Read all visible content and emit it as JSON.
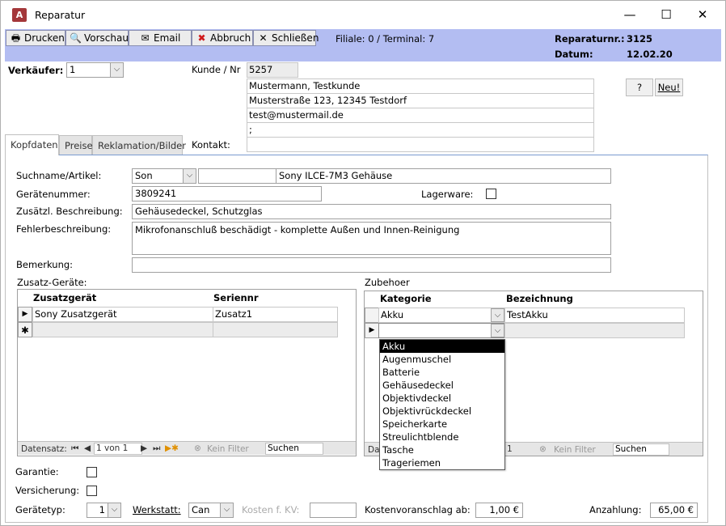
{
  "window": {
    "title": "Reparatur",
    "minimize": "—",
    "maximize": "☐",
    "close": "✕"
  },
  "app_icon": "A",
  "toolbar": {
    "buttons": [
      {
        "label": "Drucken",
        "icon": "🖶"
      },
      {
        "label": "Vorschau",
        "icon": "🔍"
      },
      {
        "label": "Email",
        "icon": "✉"
      },
      {
        "label": "Abbruch",
        "icon": "✖"
      },
      {
        "label": "Schließen",
        "icon": "✕"
      }
    ],
    "filiale": "Filiale: 0 / Terminal:  7",
    "rep_label": "Reparaturnr.:",
    "rep_value": "3125",
    "datum_label": "Datum:",
    "datum_value": "12.02.20"
  },
  "header": {
    "verkaeufer_label": "Verkäufer:",
    "verkaeufer_value": "1",
    "kunde_label": "Kunde / Nr",
    "kunde_nr": "5257",
    "kontakt_label": "Kontakt:",
    "address": [
      "Mustermann, Testkunde",
      "Musterstraße 123, 12345 Testdorf",
      "test@mustermail.de",
      ";",
      ""
    ],
    "help_btn": "?",
    "neu_btn": "Neu!"
  },
  "tabs": [
    "Kopfdaten",
    "Preise",
    "Reklamation/Bilder"
  ],
  "form": {
    "suchname_label": "Suchname/Artikel:",
    "suchname_value": "Son",
    "artikel_value": "Sony ILCE-7M3 Gehäuse",
    "geraetenr_label": "Gerätenummer:",
    "geraetenr_value": "3809241",
    "lager_label": "Lagerware:",
    "zusatz_label": "Zusätzl. Beschreibung:",
    "zusatz_value": "Gehäusedeckel, Schutzglas",
    "fehler_label": "Fehlerbeschreibung:",
    "fehler_value": "Mikrofonanschluß beschädigt - komplette Außen und Innen-Reinigung",
    "bemerkung_label": "Bemerkung:",
    "bemerkung_value": ""
  },
  "zusatzgeraete": {
    "title": "Zusatz-Geräte:",
    "headers": [
      "Zusatzgerät",
      "Seriennr"
    ],
    "rows": [
      [
        "Sony Zusatzgerät",
        "Zusatz1"
      ]
    ],
    "new_row_marker": "✱",
    "nav": {
      "label": "Datensatz:",
      "pos": "1 von 1",
      "filter": "Kein Filter",
      "search": "Suchen"
    }
  },
  "zubehoer": {
    "title": "Zubehoer",
    "headers": [
      "Kategorie",
      "Bezeichnung"
    ],
    "rows": [
      [
        "Akku",
        "TestAkku"
      ]
    ],
    "nav": {
      "label": "Da",
      "pos": "1",
      "filter": "Kein Filter",
      "search": "Suchen"
    },
    "dropdown": [
      "Akku",
      "Augenmuschel",
      "Batterie",
      "Gehäusedeckel",
      "Objektivdeckel",
      "Objektivrückdeckel",
      "Speicherkarte",
      "Streulichtblende",
      "Tasche",
      "Trageriemen"
    ],
    "dropdown_selected": "Akku"
  },
  "footer": {
    "garantie_label": "Garantie:",
    "versicherung_label": "Versicherung:",
    "geraetetyp_label": "Gerätetyp:",
    "geraetetyp_value": "1",
    "werkstatt_label": "Werkstatt:",
    "werkstatt_value": "Can",
    "kosten_label": "Kosten f. KV:",
    "kosten_value": "",
    "kv_label": "Kostenvoranschlag ab:",
    "kv_value": "1,00 €",
    "anzahlung_label": "Anzahlung:",
    "anzahlung_value": "65,00 €"
  }
}
